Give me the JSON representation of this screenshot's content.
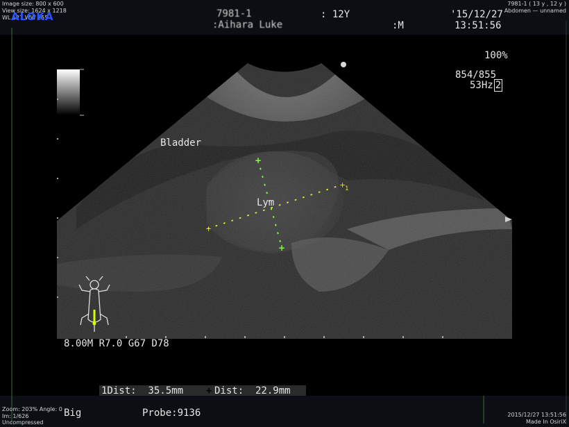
{
  "header": {
    "image_size": "Image size: 800 x 600",
    "view_size": "View size: 1624 x 1218",
    "wl_ww": "WL 127 WW 255",
    "brand": "ALOKA",
    "patient_id": "7981-1",
    "patient_name": ":Aihara Luke",
    "age": ": 12Y",
    "sex": ":M",
    "date": "'15/12/27",
    "time": "13:51:56",
    "series_info": "7981-1 ( 13 y , 12 y )",
    "series_desc": "Abdomen — unnamed"
  },
  "overlay": {
    "gain_percent": "100%",
    "frame_count": "854/855",
    "frequency": "53Hz",
    "frequency_box": "2",
    "bladder_label": "Bladder",
    "lesion_label": "Lym",
    "marker_1": "1",
    "params": "8.00M R7.0 G67 D78"
  },
  "measurements": {
    "dist1": "1Dist:  35.5mm",
    "dist2_symbol": "+",
    "dist2": "Dist:  22.9mm"
  },
  "footer": {
    "zoom": "Zoom: 203% Angle: 0",
    "image_no": "Im: 1/626",
    "compression": "Uncompressed",
    "preset": "Big",
    "probe": "Probe:9136",
    "datetime": "2015/12/27 13:51:56",
    "made_in": "Made In OsiriX"
  },
  "colors": {
    "caliper": "#7fff3a",
    "brand": "#2b54ff",
    "text": "#e6e6e6"
  },
  "icons": {
    "body_mark": "supine-animal-body-mark-icon"
  }
}
